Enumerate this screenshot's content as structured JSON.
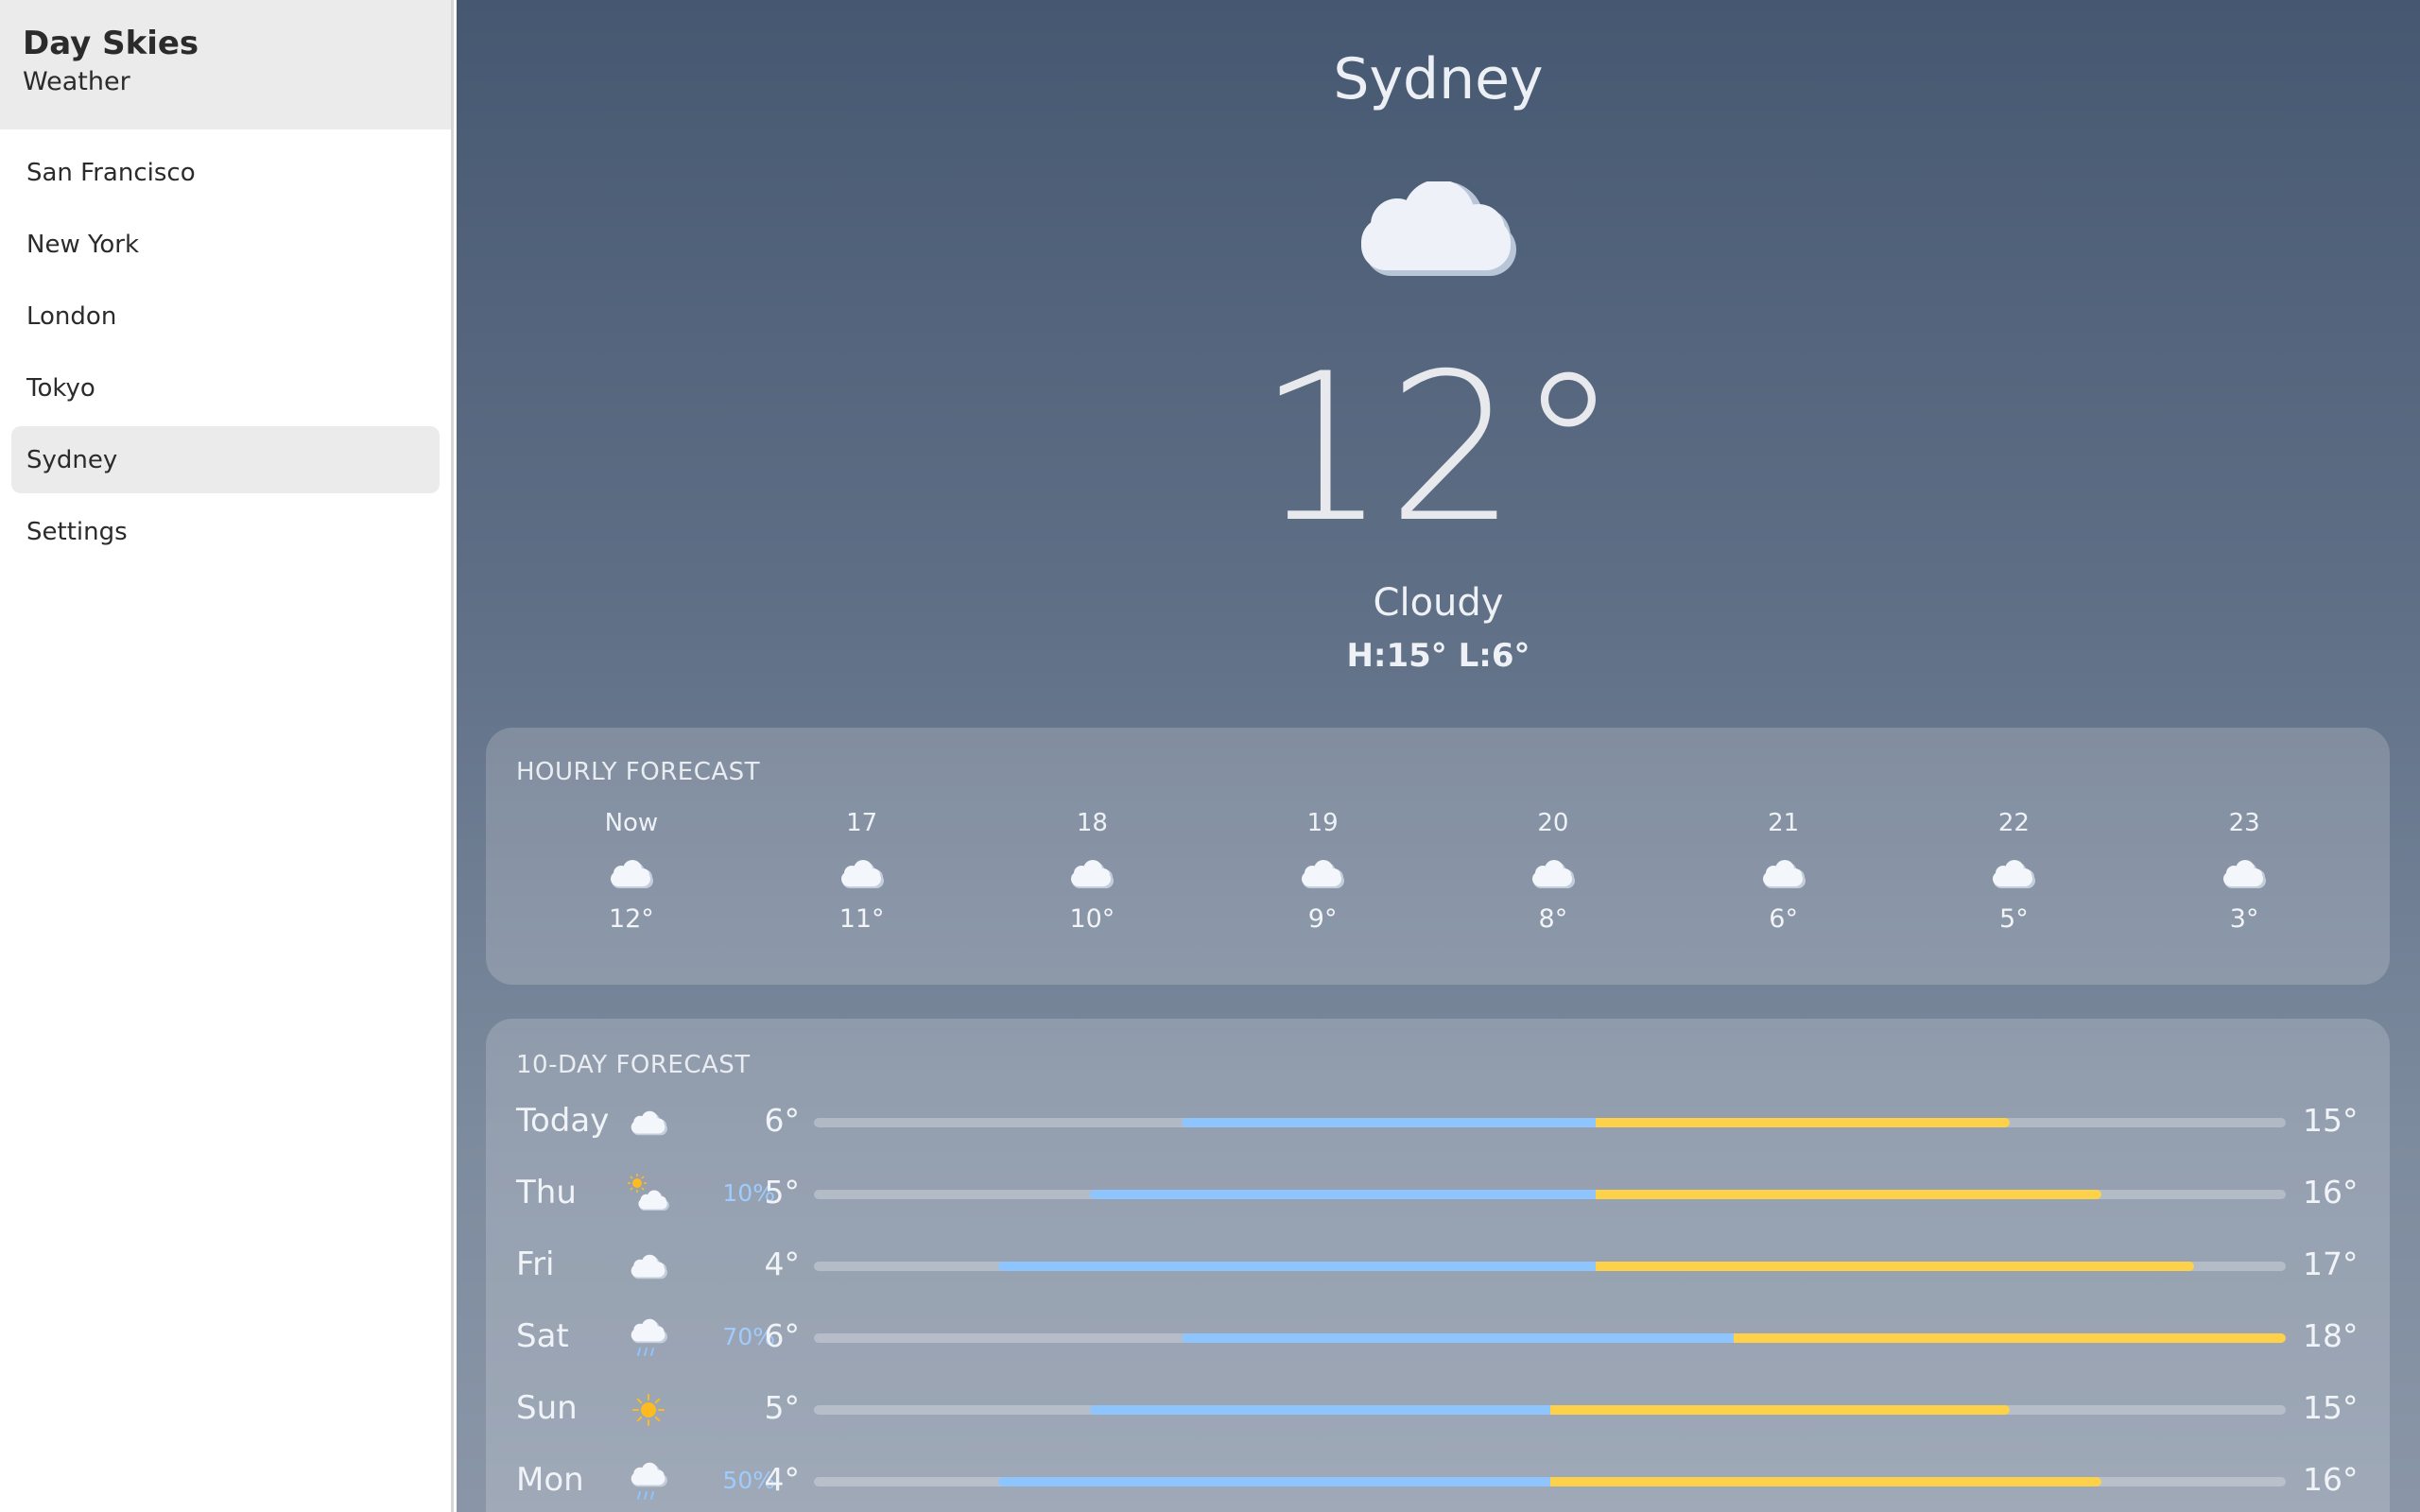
{
  "app": {
    "title": "Day Skies",
    "subtitle": "Weather"
  },
  "sidebar": {
    "items": [
      {
        "label": "San Francisco",
        "active": false
      },
      {
        "label": "New York",
        "active": false
      },
      {
        "label": "London",
        "active": false
      },
      {
        "label": "Tokyo",
        "active": false
      },
      {
        "label": "Sydney",
        "active": true
      },
      {
        "label": "Settings",
        "active": false
      }
    ]
  },
  "current": {
    "city": "Sydney",
    "icon": "cloud-icon",
    "temperature": "12°",
    "condition": "Cloudy",
    "hi_lo": "H:15° L:6°"
  },
  "hourly": {
    "title": "HOURLY FORECAST",
    "hours": [
      {
        "label": "Now",
        "icon": "cloud-icon",
        "temp": "12°"
      },
      {
        "label": "17",
        "icon": "cloud-icon",
        "temp": "11°"
      },
      {
        "label": "18",
        "icon": "cloud-icon",
        "temp": "10°"
      },
      {
        "label": "19",
        "icon": "cloud-icon",
        "temp": "9°"
      },
      {
        "label": "20",
        "icon": "cloud-icon",
        "temp": "8°"
      },
      {
        "label": "21",
        "icon": "cloud-icon",
        "temp": "6°"
      },
      {
        "label": "22",
        "icon": "cloud-icon",
        "temp": "5°"
      },
      {
        "label": "23",
        "icon": "cloud-icon",
        "temp": "3°"
      }
    ]
  },
  "daily": {
    "title": "10-DAY FORECAST",
    "range": {
      "min": 2,
      "max": 18
    },
    "days": [
      {
        "day": "Today",
        "icon": "cloud-icon",
        "precip": "",
        "low": "6°",
        "high": "15°",
        "low_value": 6,
        "high_value": 15
      },
      {
        "day": "Thu",
        "icon": "partly-cloudy-icon",
        "precip": "10%",
        "low": "5°",
        "high": "16°",
        "low_value": 5,
        "high_value": 16
      },
      {
        "day": "Fri",
        "icon": "cloud-icon",
        "precip": "",
        "low": "4°",
        "high": "17°",
        "low_value": 4,
        "high_value": 17
      },
      {
        "day": "Sat",
        "icon": "rain-icon",
        "precip": "70%",
        "low": "6°",
        "high": "18°",
        "low_value": 6,
        "high_value": 18
      },
      {
        "day": "Sun",
        "icon": "sun-icon",
        "precip": "",
        "low": "5°",
        "high": "15°",
        "low_value": 5,
        "high_value": 15
      },
      {
        "day": "Mon",
        "icon": "rain-icon",
        "precip": "50%",
        "low": "4°",
        "high": "16°",
        "low_value": 4,
        "high_value": 16
      }
    ]
  },
  "colors": {
    "cold": "#8ec5ff",
    "warm": "#fdd24a",
    "precip": "#9fcbff",
    "sun": "#fdbb1f"
  }
}
